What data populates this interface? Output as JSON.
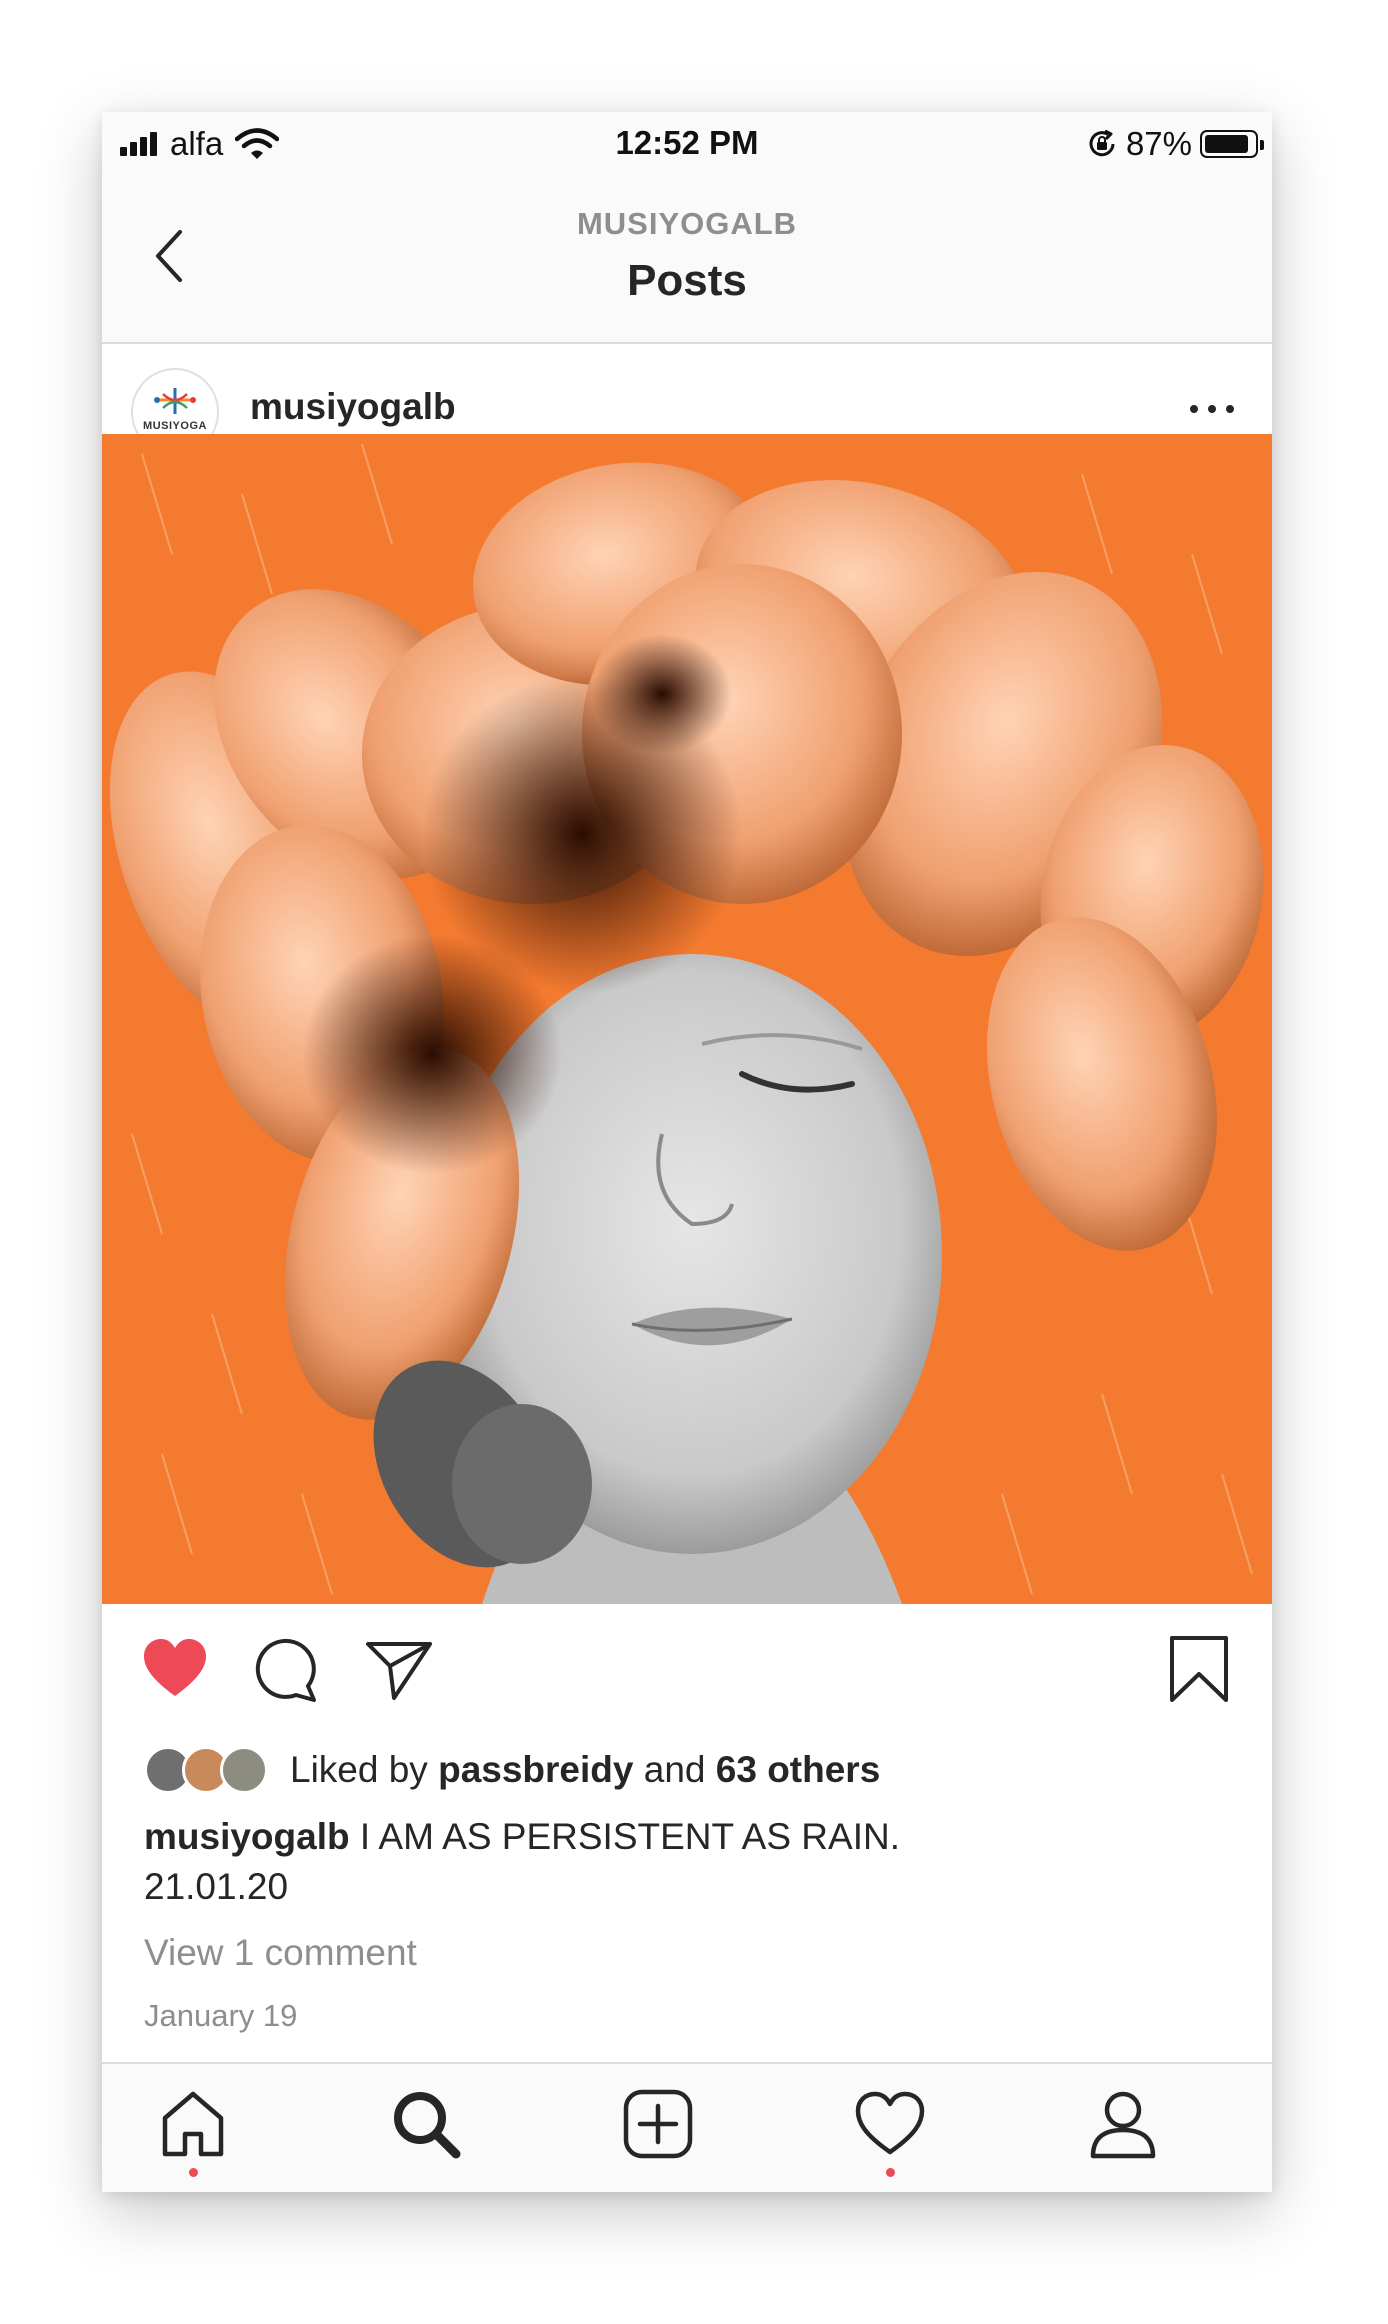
{
  "status_bar": {
    "carrier": "alfa",
    "time": "12:52 PM",
    "battery_percent": "87%",
    "battery_level": 0.87,
    "icons": [
      "signal-icon",
      "wifi-icon",
      "rotation-lock-icon",
      "battery-icon"
    ]
  },
  "nav": {
    "subtitle": "MUSIYOGALB",
    "title": "Posts",
    "back_icon": "chevron-left-icon"
  },
  "post": {
    "username": "musiyogalb",
    "avatar_text": "MUSIYOGA",
    "more_icon": "more-horizontal-icon",
    "liked": true,
    "like_icon": "heart-filled-icon",
    "comment_icon": "comment-icon",
    "share_icon": "send-icon",
    "save_icon": "bookmark-icon",
    "likes": {
      "prefix": "Liked by ",
      "user": "passbreidy",
      "middle": " and ",
      "others": "63 others"
    },
    "caption_user": "musiyogalb",
    "caption_text": " I AM AS PERSISTENT AS RAIN.",
    "caption_line2": "21.01.20",
    "view_comments": "View 1 comment",
    "date": "January 19"
  },
  "tab_bar": {
    "items": [
      {
        "name": "home",
        "icon": "home-icon",
        "has_dot": true
      },
      {
        "name": "search",
        "icon": "search-icon",
        "has_dot": false
      },
      {
        "name": "new-post",
        "icon": "add-post-icon",
        "has_dot": false
      },
      {
        "name": "activity",
        "icon": "heart-icon",
        "has_dot": true
      },
      {
        "name": "profile",
        "icon": "profile-icon",
        "has_dot": false
      }
    ]
  },
  "colors": {
    "accent_like": "#ed4956",
    "image_background": "#f47a30",
    "secondary_text": "#8e8e8e",
    "primary_text": "#262626"
  }
}
